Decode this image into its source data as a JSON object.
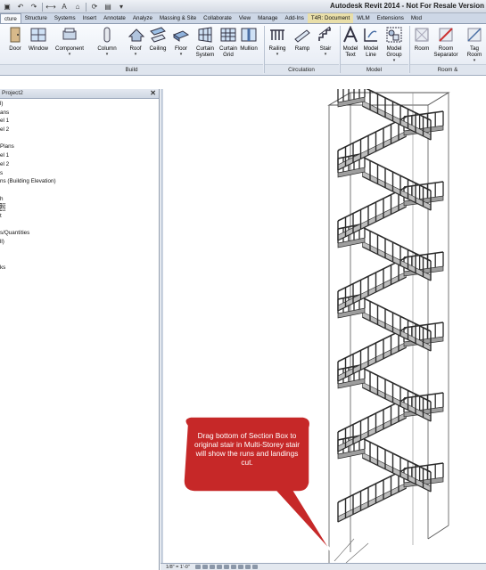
{
  "app_title": "Autodesk Revit 2014 - Not For Resale Version",
  "qat": [
    "open-icon",
    "undo-icon",
    "redo-icon",
    "measure-icon",
    "text-icon",
    "3d-view-icon",
    "sync-icon",
    "switch-windows-icon",
    "dropdown-icon"
  ],
  "tabs": [
    {
      "label": "cture",
      "active": true
    },
    {
      "label": "Structure"
    },
    {
      "label": "Systems"
    },
    {
      "label": "Insert"
    },
    {
      "label": "Annotate"
    },
    {
      "label": "Analyze"
    },
    {
      "label": "Massing & Site"
    },
    {
      "label": "Collaborate"
    },
    {
      "label": "View"
    },
    {
      "label": "Manage"
    },
    {
      "label": "Add-Ins"
    },
    {
      "label": "T4R: Document",
      "highlight": true
    },
    {
      "label": "WLM"
    },
    {
      "label": "Extensions"
    },
    {
      "label": "Mod"
    }
  ],
  "ribbon": {
    "buttons": [
      {
        "label": "Door",
        "icon": "door-icon"
      },
      {
        "label": "Window",
        "icon": "window-icon"
      },
      {
        "label": "Component",
        "icon": "component-icon",
        "dropdown": true
      },
      {
        "label": "Column",
        "icon": "column-icon",
        "dropdown": true
      },
      {
        "label": "Roof",
        "icon": "roof-icon",
        "dropdown": true
      },
      {
        "label": "Ceiling",
        "icon": "ceiling-icon"
      },
      {
        "label": "Floor",
        "icon": "floor-icon",
        "dropdown": true
      },
      {
        "label": "Curtain System",
        "icon": "curtain-system-icon"
      },
      {
        "label": "Curtain Grid",
        "icon": "curtain-grid-icon"
      },
      {
        "label": "Mullion",
        "icon": "mullion-icon"
      },
      {
        "label": "Railing",
        "icon": "railing-icon",
        "dropdown": true
      },
      {
        "label": "Ramp",
        "icon": "ramp-icon"
      },
      {
        "label": "Stair",
        "icon": "stair-icon",
        "dropdown": true
      },
      {
        "label": "Model Text",
        "icon": "model-text-icon"
      },
      {
        "label": "Model Line",
        "icon": "model-line-icon"
      },
      {
        "label": "Model Group",
        "icon": "model-group-icon",
        "dropdown": true
      },
      {
        "label": "Room",
        "icon": "room-icon"
      },
      {
        "label": "Room Separator",
        "icon": "room-separator-icon"
      },
      {
        "label": "Tag Room",
        "icon": "tag-room-icon",
        "dropdown": true
      }
    ],
    "groups": [
      "Build",
      "Circulation",
      "Model",
      "Room &"
    ]
  },
  "project_browser": {
    "title": "Project2",
    "close": "✕",
    "items": [
      "l)",
      "ans",
      "el 1",
      "el 2",
      "",
      "Plans",
      "el 1",
      "el 2",
      "s",
      "ns (Building Elevation)",
      "",
      "h",
      "h",
      "t",
      "",
      "s/Quantities",
      "ll)",
      "",
      "",
      "ks"
    ],
    "selected_index": 12
  },
  "callout": {
    "text": "Drag bottom of Section Box to original stair in Multi-Storey stair will show the runs and landings cut.",
    "fill": "#c62828",
    "stroke": "#ffffff"
  },
  "status": {
    "scale": "1/8\" = 1'-0\""
  },
  "colors": {
    "stair": "#2a2a2a",
    "section_box": "#555555"
  }
}
